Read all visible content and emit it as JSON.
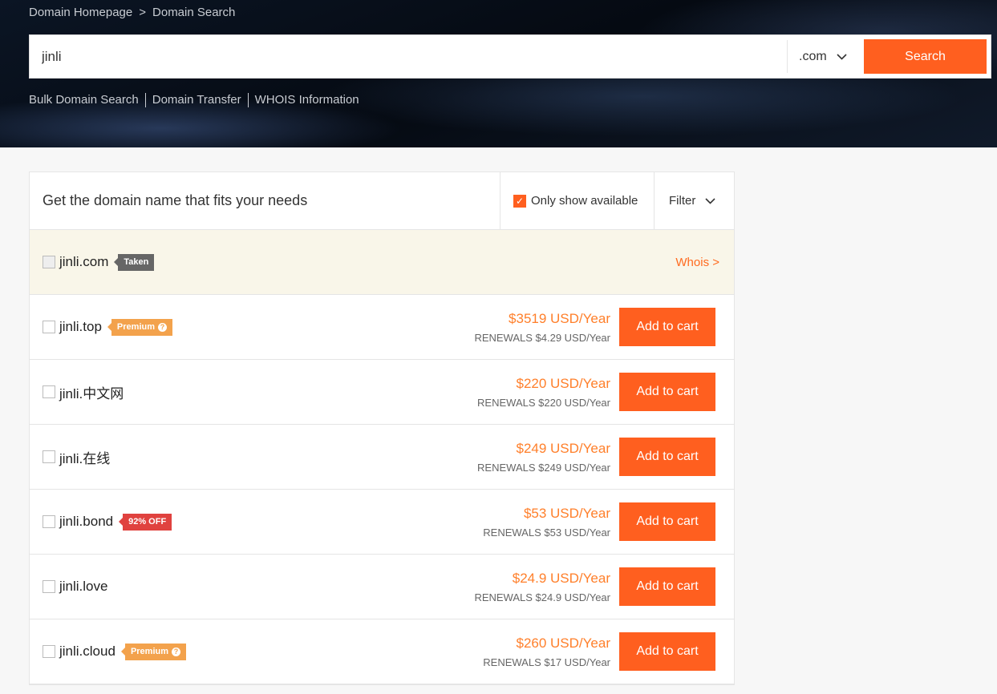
{
  "breadcrumb": {
    "home": "Domain Homepage",
    "sep": ">",
    "current": "Domain Search"
  },
  "search": {
    "value": "jinli",
    "tld": ".com",
    "button": "Search"
  },
  "links": [
    "Bulk Domain Search",
    "Domain Transfer",
    "WHOIS Information"
  ],
  "panel": {
    "title": "Get the domain name that fits your needs",
    "only_available": "Only show available",
    "only_available_checked": true,
    "filter": "Filter"
  },
  "taken": {
    "domain": "jinli.com",
    "badge": "Taken",
    "whois": "Whois >"
  },
  "rows": [
    {
      "domain": "jinli.top",
      "badge": "Premium",
      "badge_type": "premium",
      "price": "$3519 USD/Year",
      "renewal": "RENEWALS $4.29 USD/Year",
      "action": "Add to cart"
    },
    {
      "domain": "jinli.中文网",
      "badge": "",
      "price": "$220 USD/Year",
      "renewal": "RENEWALS $220 USD/Year",
      "action": "Add to cart"
    },
    {
      "domain": "jinli.在线",
      "badge": "",
      "price": "$249 USD/Year",
      "renewal": "RENEWALS $249 USD/Year",
      "action": "Add to cart"
    },
    {
      "domain": "jinli.bond",
      "badge": "92% OFF",
      "badge_type": "discount",
      "price": "$53 USD/Year",
      "renewal": "RENEWALS $53 USD/Year",
      "action": "Add to cart"
    },
    {
      "domain": "jinli.love",
      "badge": "",
      "price": "$24.9 USD/Year",
      "renewal": "RENEWALS $24.9 USD/Year",
      "action": "Add to cart"
    },
    {
      "domain": "jinli.cloud",
      "badge": "Premium",
      "badge_type": "premium",
      "price": "$260 USD/Year",
      "renewal": "RENEWALS $17 USD/Year",
      "action": "Add to cart"
    }
  ],
  "colors": {
    "accent": "#ff5f1f",
    "price": "#ff7f2a",
    "premium": "#f3a24c",
    "discount": "#e0423f",
    "taken": "#666666"
  }
}
